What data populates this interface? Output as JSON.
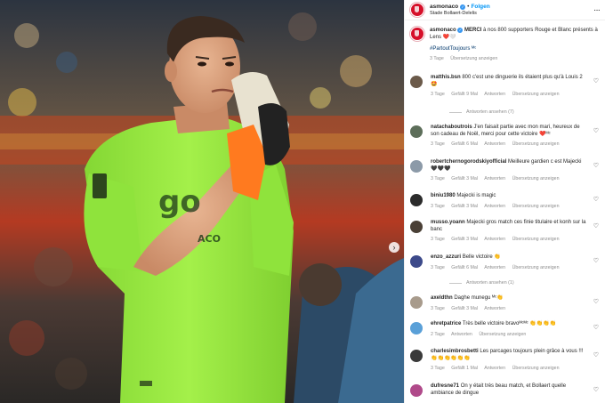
{
  "post": {
    "account": "asmonaco",
    "follow_label": "Folgen",
    "location": "Stade Bollaert-Delelis",
    "caption_user": "asmonaco",
    "caption_bold": "MERCI",
    "caption_text": "à nos 800 supporters Rouge et Blanc présents à Lens ❤️🤍",
    "hashtag": "#PartoutToujours",
    "hashtag_suffix": "ᴹᶜ",
    "time": "3 Tage",
    "translation_label": "Übersetzung anzeigen"
  },
  "photo": {
    "shirt_text": "ACO"
  },
  "comments": [
    {
      "user": "matthis.bsn",
      "text": "800 c'est une dinguerie ils étaient plus qu'à Louis 2 🤩",
      "time": "3 Tage",
      "likes": "Gefällt 9 Mal",
      "reply": "Antworten",
      "translate": "Übersetzung anzeigen",
      "view_replies": "Antworten ansehen (7)",
      "avatar_color": "#6b5a4a"
    },
    {
      "user": "natachaboutrois",
      "text": "J'en faisait partie avec mon mari, heureux de son cadeau de Noël, merci pour cette victoire ❤️ᴹᶜ",
      "time": "3 Tage",
      "likes": "Gefällt 6 Mal",
      "reply": "Antworten",
      "translate": "Übersetzung anzeigen",
      "avatar_color": "#5d6e5a"
    },
    {
      "user": "robertchernogorodskiyofficial",
      "text": "Meilleure gardien c est Majecki 🖤🖤🖤",
      "time": "3 Tage",
      "likes": "Gefällt 3 Mal",
      "reply": "Antworten",
      "translate": "Übersetzung anzeigen",
      "avatar_color": "#8c9aa8"
    },
    {
      "user": "biniu1980",
      "text": "Majecki is magic",
      "time": "3 Tage",
      "likes": "Gefällt 3 Mal",
      "reply": "Antworten",
      "translate": "Übersetzung anzeigen",
      "avatar_color": "#2b2b2b"
    },
    {
      "user": "musso.yoann",
      "text": "Majecki gros match ces finie titulaire et konh sur la banc",
      "time": "3 Tage",
      "likes": "Gefällt 3 Mal",
      "reply": "Antworten",
      "translate": "Übersetzung anzeigen",
      "avatar_color": "#4a4036"
    },
    {
      "user": "enzo_azzuri",
      "text": "Belle victoire 👏",
      "time": "3 Tage",
      "likes": "Gefällt 6 Mal",
      "reply": "Antworten",
      "translate": "Übersetzung anzeigen",
      "view_replies": "Antworten ansehen (1)",
      "avatar_color": "#3d4a8a"
    },
    {
      "user": "axeldthn",
      "text": "Daghe munegu ᴹᶜ👏",
      "time": "3 Tage",
      "likes": "Gefällt 3 Mal",
      "reply": "Antworten",
      "avatar_color": "#a89b8c"
    },
    {
      "user": "ehretpatrice",
      "text": "Très belle victoire bravoᴹᶜᴹᶜ 👏👏👏👏",
      "time": "2 Tage",
      "reply": "Antworten",
      "translate": "Übersetzung anzeigen",
      "avatar_color": "#5aa0d8"
    },
    {
      "user": "charlesimbrosbetti",
      "text": "Les parcages toujours plein grâce à vous !!! 👏👏👏👏👏👏",
      "time": "3 Tage",
      "likes": "Gefällt 1 Mal",
      "reply": "Antworten",
      "translate": "Übersetzung anzeigen",
      "avatar_color": "#3a3a3a"
    },
    {
      "user": "dufresne71",
      "text": "On y était très beau match, et Bollaert quelle ambiance de dingue",
      "avatar_color": "#b04a8a"
    }
  ],
  "colors": {
    "jersey": "#9bea3e",
    "club_red": "#d6102a",
    "link_blue": "#0095f6"
  },
  "icons": {
    "heart": "♡",
    "more": "···",
    "next": "›",
    "verified": "✓"
  }
}
